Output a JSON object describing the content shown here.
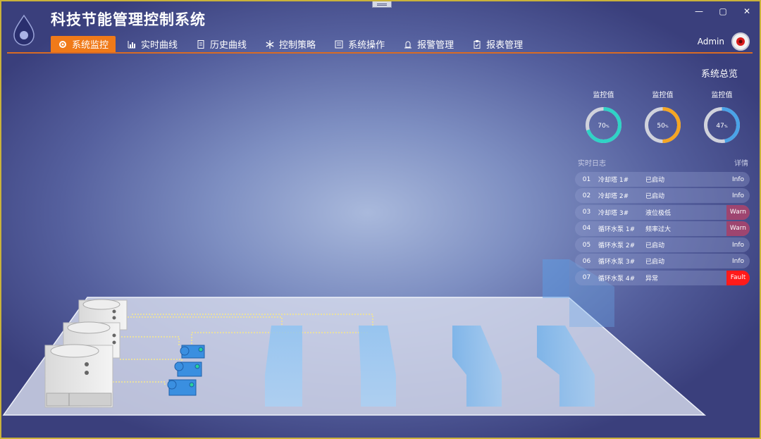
{
  "app": {
    "title": "科技节能管理控制系统"
  },
  "window_controls": [
    "—",
    "▢",
    "✕"
  ],
  "nav": [
    {
      "label": "系统监控",
      "icon": "gear-icon",
      "active": true
    },
    {
      "label": "实时曲线",
      "icon": "bar-chart-icon",
      "active": false
    },
    {
      "label": "历史曲线",
      "icon": "document-icon",
      "active": false
    },
    {
      "label": "控制策略",
      "icon": "snowflake-icon",
      "active": false
    },
    {
      "label": "系统操作",
      "icon": "list-icon",
      "active": false
    },
    {
      "label": "报警管理",
      "icon": "alarm-icon",
      "active": false
    },
    {
      "label": "报表管理",
      "icon": "clipboard-icon",
      "active": false
    }
  ],
  "user": {
    "name": "Admin"
  },
  "overview": {
    "title": "系统总览",
    "gauges": [
      {
        "label": "监控值",
        "value": 70,
        "unit": "%",
        "color": "#2fd3c6"
      },
      {
        "label": "监控值",
        "value": 50,
        "unit": "%",
        "color": "#f5a623"
      },
      {
        "label": "监控值",
        "value": 47,
        "unit": "%",
        "color": "#4aa3e8"
      }
    ]
  },
  "log": {
    "title": "实时日志",
    "detail_label": "详情",
    "rows": [
      {
        "no": "01",
        "device": "冷却塔 1#",
        "status": "已启动",
        "level": "Info"
      },
      {
        "no": "02",
        "device": "冷却塔 2#",
        "status": "已启动",
        "level": "Info"
      },
      {
        "no": "03",
        "device": "冷却塔 3#",
        "status": "液位极低",
        "level": "Warn"
      },
      {
        "no": "04",
        "device": "循环水泵 1#",
        "status": "频率过大",
        "level": "Warn"
      },
      {
        "no": "05",
        "device": "循环水泵 2#",
        "status": "已启动",
        "level": "Info"
      },
      {
        "no": "06",
        "device": "循环水泵 3#",
        "status": "已启动",
        "level": "Info"
      },
      {
        "no": "07",
        "device": "循环水泵 4#",
        "status": "异常",
        "level": "Fault"
      }
    ]
  }
}
